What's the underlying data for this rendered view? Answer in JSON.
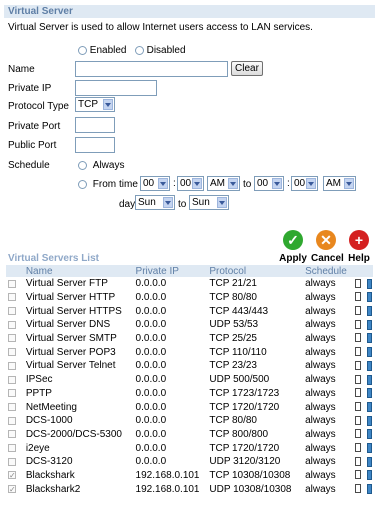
{
  "virtual_server": {
    "title": "Virtual Server",
    "description": "Virtual Server is used to allow Internet users access to LAN services.",
    "enabled_label": "Enabled",
    "disabled_label": "Disabled",
    "name_label": "Name",
    "name_value": "",
    "clear_label": "Clear",
    "private_ip_label": "Private IP",
    "private_ip_value": "",
    "protocol_type_label": "Protocol Type",
    "protocol_value": "TCP",
    "private_port_label": "Private Port",
    "private_port_value": "",
    "public_port_label": "Public Port",
    "public_port_value": "",
    "schedule_label": "Schedule",
    "always_label": "Always",
    "from_label": "From",
    "time_label": "time",
    "from_hour": "00",
    "from_min": "00",
    "from_ampm": "AM",
    "to_label": "to",
    "to_hour": "00",
    "to_min": "00",
    "to_ampm": "AM",
    "colon": ":",
    "day_label": "day",
    "day_from": "Sun",
    "day_to_label": "to",
    "day_to": "Sun"
  },
  "actions": {
    "apply_label": "Apply",
    "cancel_label": "Cancel",
    "help_label": "Help",
    "apply_color": "#2fa82f",
    "cancel_color": "#e8871e",
    "help_color": "#d42020"
  },
  "list": {
    "title": "Virtual Servers List",
    "columns": [
      "Name",
      "Private IP",
      "Protocol",
      "Schedule"
    ],
    "rows": [
      {
        "checked": false,
        "name": "Virtual Server FTP",
        "ip": "0.0.0.0",
        "protocol": "TCP 21/21",
        "schedule": "always"
      },
      {
        "checked": false,
        "name": "Virtual Server HTTP",
        "ip": "0.0.0.0",
        "protocol": "TCP 80/80",
        "schedule": "always"
      },
      {
        "checked": false,
        "name": "Virtual Server HTTPS",
        "ip": "0.0.0.0",
        "protocol": "TCP 443/443",
        "schedule": "always"
      },
      {
        "checked": false,
        "name": "Virtual Server DNS",
        "ip": "0.0.0.0",
        "protocol": "UDP 53/53",
        "schedule": "always"
      },
      {
        "checked": false,
        "name": "Virtual Server SMTP",
        "ip": "0.0.0.0",
        "protocol": "TCP 25/25",
        "schedule": "always"
      },
      {
        "checked": false,
        "name": "Virtual Server POP3",
        "ip": "0.0.0.0",
        "protocol": "TCP 110/110",
        "schedule": "always"
      },
      {
        "checked": false,
        "name": "Virtual Server Telnet",
        "ip": "0.0.0.0",
        "protocol": "TCP 23/23",
        "schedule": "always"
      },
      {
        "checked": false,
        "name": "IPSec",
        "ip": "0.0.0.0",
        "protocol": "UDP 500/500",
        "schedule": "always"
      },
      {
        "checked": false,
        "name": "PPTP",
        "ip": "0.0.0.0",
        "protocol": "TCP 1723/1723",
        "schedule": "always"
      },
      {
        "checked": false,
        "name": "NetMeeting",
        "ip": "0.0.0.0",
        "protocol": "TCP 1720/1720",
        "schedule": "always"
      },
      {
        "checked": false,
        "name": "DCS-1000",
        "ip": "0.0.0.0",
        "protocol": "TCP 80/80",
        "schedule": "always"
      },
      {
        "checked": false,
        "name": "DCS-2000/DCS-5300",
        "ip": "0.0.0.0",
        "protocol": "TCP 800/800",
        "schedule": "always"
      },
      {
        "checked": false,
        "name": "i2eye",
        "ip": "0.0.0.0",
        "protocol": "TCP 1720/1720",
        "schedule": "always"
      },
      {
        "checked": false,
        "name": "DCS-3120",
        "ip": "0.0.0.0",
        "protocol": "UDP 3120/3120",
        "schedule": "always"
      },
      {
        "checked": true,
        "name": "Blackshark",
        "ip": "192.168.0.101",
        "protocol": "TCP 10308/10308",
        "schedule": "always"
      },
      {
        "checked": true,
        "name": "Blackshark2",
        "ip": "192.168.0.101",
        "protocol": "UDP 10308/10308",
        "schedule": "always"
      }
    ]
  }
}
